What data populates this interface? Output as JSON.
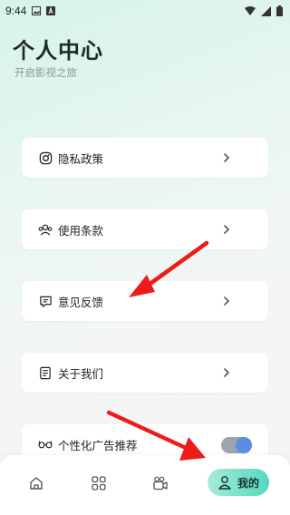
{
  "status": {
    "time": "9:44"
  },
  "header": {
    "title": "个人中心",
    "subtitle": "开启影视之旅"
  },
  "menu": [
    {
      "label": "隐私政策",
      "icon": "privacy-icon"
    },
    {
      "label": "使用条款",
      "icon": "users-icon"
    },
    {
      "label": "意见反馈",
      "icon": "feedback-icon"
    },
    {
      "label": "关于我们",
      "icon": "about-icon"
    }
  ],
  "ad_toggle": {
    "label": "个性化广告推荐",
    "on": true
  },
  "tabs": {
    "active_label": "我的"
  },
  "colors": {
    "accent": "#57d6c0",
    "toggle_knob": "#5c8de3",
    "arrow": "#ee1b1b"
  }
}
